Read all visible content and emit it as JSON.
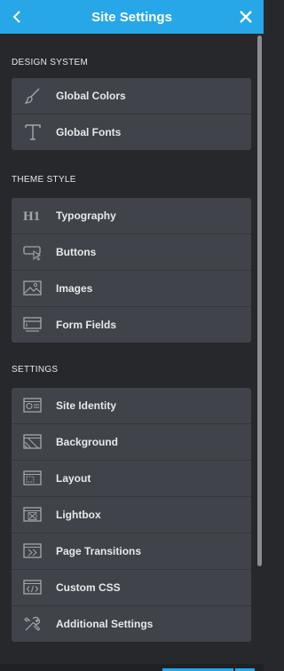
{
  "header": {
    "title": "Site Settings",
    "back_icon": "chevron-left-icon",
    "close_icon": "close-icon",
    "color": "#27a7e8"
  },
  "sections": [
    {
      "title": "DESIGN SYSTEM",
      "items": [
        {
          "label": "Global Colors",
          "icon": "brush-icon"
        },
        {
          "label": "Global Fonts",
          "icon": "text-t-icon"
        }
      ]
    },
    {
      "title": "THEME STYLE",
      "items": [
        {
          "label": "Typography",
          "icon": "heading-h1-icon"
        },
        {
          "label": "Buttons",
          "icon": "button-cursor-icon"
        },
        {
          "label": "Images",
          "icon": "image-icon"
        },
        {
          "label": "Form Fields",
          "icon": "form-field-icon"
        }
      ]
    },
    {
      "title": "SETTINGS",
      "items": [
        {
          "label": "Site Identity",
          "icon": "id-card-icon"
        },
        {
          "label": "Background",
          "icon": "background-icon"
        },
        {
          "label": "Layout",
          "icon": "layout-icon"
        },
        {
          "label": "Lightbox",
          "icon": "lightbox-icon"
        },
        {
          "label": "Page Transitions",
          "icon": "page-transitions-icon"
        },
        {
          "label": "Custom CSS",
          "icon": "code-icon"
        },
        {
          "label": "Additional Settings",
          "icon": "tools-icon"
        }
      ]
    }
  ]
}
